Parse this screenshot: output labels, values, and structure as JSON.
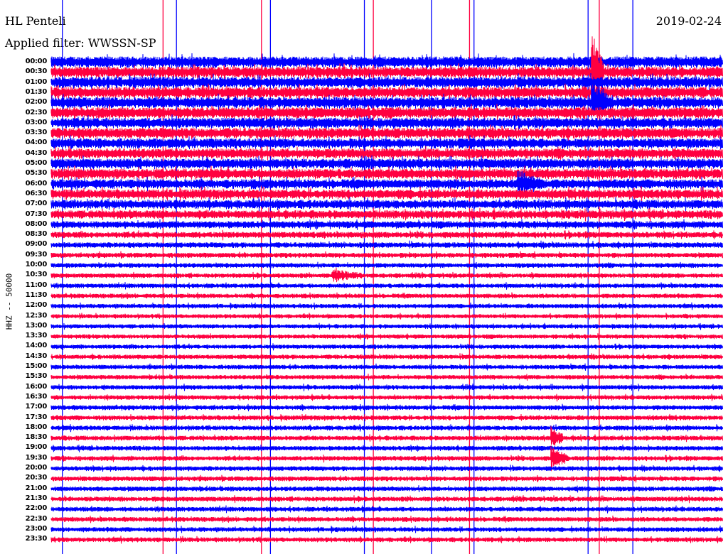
{
  "header": {
    "station": "HL Penteli",
    "filter": "Applied filter: WWSSN-SP",
    "date": "2019-02-24"
  },
  "chart_data": {
    "type": "line",
    "title": "HL Penteli",
    "ylabel": "HHZ -- 50000",
    "xlabel": "",
    "x_range_minutes": [
      0,
      30
    ],
    "row_labels": [
      "00:00",
      "00:30",
      "01:00",
      "01:30",
      "02:00",
      "02:30",
      "03:00",
      "03:30",
      "04:00",
      "04:30",
      "05:00",
      "05:30",
      "06:00",
      "06:30",
      "07:00",
      "07:30",
      "08:00",
      "08:30",
      "09:00",
      "09:30",
      "10:00",
      "10:30",
      "11:00",
      "11:30",
      "12:00",
      "12:30",
      "13:00",
      "13:30",
      "14:00",
      "14:30",
      "15:00",
      "15:30",
      "16:00",
      "16:30",
      "17:00",
      "17:30",
      "18:00",
      "18:30",
      "19:00",
      "19:30",
      "20:00",
      "20:30",
      "21:00",
      "21:30",
      "22:00",
      "22:30",
      "23:00",
      "23:30"
    ],
    "row_noise_level": [
      1,
      1,
      1,
      1,
      1,
      1,
      0.95,
      0.95,
      0.9,
      0.9,
      0.9,
      0.9,
      0.85,
      0.85,
      0.8,
      0.75,
      0.65,
      0.55,
      0.5,
      0.45,
      0.42,
      0.4,
      0.4,
      0.4,
      0.4,
      0.38,
      0.38,
      0.38,
      0.38,
      0.4,
      0.4,
      0.4,
      0.4,
      0.4,
      0.42,
      0.42,
      0.42,
      0.42,
      0.42,
      0.42,
      0.42,
      0.42,
      0.42,
      0.42,
      0.42,
      0.42,
      0.42,
      0.42
    ],
    "series_colors": [
      "#0000ff",
      "#ff0040"
    ],
    "events": [
      {
        "row": 1,
        "minute": 24.2,
        "amplitude": 6,
        "duration_min": 0.4
      },
      {
        "row": 4,
        "minute": 24.2,
        "amplitude": 3,
        "duration_min": 0.6
      },
      {
        "row": 12,
        "minute": 20.9,
        "amplitude": 2,
        "duration_min": 1.0
      },
      {
        "row": 21,
        "minute": 12.6,
        "amplitude": 2,
        "duration_min": 1.2
      },
      {
        "row": 37,
        "minute": 22.4,
        "amplitude": 4,
        "duration_min": 0.4
      },
      {
        "row": 39,
        "minute": 22.4,
        "amplitude": 4,
        "duration_min": 0.6
      }
    ],
    "glitch_lines": [
      {
        "minute": 0.5,
        "color": "#0000ff"
      },
      {
        "minute": 5.0,
        "color": "#ff0040"
      },
      {
        "minute": 5.6,
        "color": "#0000ff"
      },
      {
        "minute": 9.4,
        "color": "#ff0040"
      },
      {
        "minute": 9.8,
        "color": "#0000ff"
      },
      {
        "minute": 14.0,
        "color": "#0000ff"
      },
      {
        "minute": 14.4,
        "color": "#ff0040"
      },
      {
        "minute": 17.0,
        "color": "#0000ff"
      },
      {
        "minute": 18.7,
        "color": "#ff0040"
      },
      {
        "minute": 18.9,
        "color": "#0000ff"
      },
      {
        "minute": 24.0,
        "color": "#0000ff"
      },
      {
        "minute": 24.5,
        "color": "#ff0040"
      },
      {
        "minute": 26.0,
        "color": "#0000ff"
      }
    ]
  }
}
